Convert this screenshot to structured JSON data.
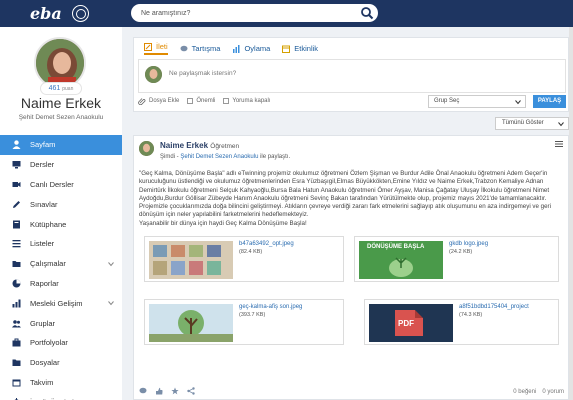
{
  "topbar": {
    "logo": "eba",
    "search_placeholder": "Ne aramıştınız?"
  },
  "profile": {
    "points_value": "461",
    "points_unit": "puan",
    "name": "Naime Erkek",
    "school": "Şehit Demet Sezen Anaokulu"
  },
  "sidebar": {
    "items": [
      {
        "label": "Sayfam",
        "icon": "user-icon",
        "active": true
      },
      {
        "label": "Dersler",
        "icon": "monitor-icon"
      },
      {
        "label": "Canlı Dersler",
        "icon": "video-icon"
      },
      {
        "label": "Sınavlar",
        "icon": "pencil-icon"
      },
      {
        "label": "Kütüphane",
        "icon": "book-icon"
      },
      {
        "label": "Listeler",
        "icon": "list-icon"
      },
      {
        "label": "Çalışmalar",
        "icon": "folder-open-icon",
        "expandable": true
      },
      {
        "label": "Raporlar",
        "icon": "chart-icon"
      },
      {
        "label": "Mesleki Gelişim",
        "icon": "bars-icon",
        "expandable": true
      },
      {
        "label": "Gruplar",
        "icon": "group-icon"
      },
      {
        "label": "Portfolyolar",
        "icon": "briefcase-icon"
      },
      {
        "label": "Dosyalar",
        "icon": "folder-icon"
      },
      {
        "label": "Takvim",
        "icon": "calendar-icon"
      },
      {
        "label": "İçerik Üretimi",
        "icon": "gear-icon",
        "expandable": true
      }
    ]
  },
  "composer": {
    "tabs": [
      {
        "label": "İleti",
        "icon": "pencil-icon",
        "active": true
      },
      {
        "label": "Tartışma",
        "icon": "chat-icon"
      },
      {
        "label": "Oylama",
        "icon": "poll-icon"
      },
      {
        "label": "Etkinlik",
        "icon": "calendar-icon"
      }
    ],
    "input_placeholder": "Ne paylaşmak istersin?",
    "attach_label": "Dosya Ekle",
    "option_draft": "Önemli",
    "option_comments": "Yoruma kapalı",
    "group_select": "Grup Seç",
    "share_button": "PAYLAŞ"
  },
  "filter": {
    "selected": "Tümünü Göster"
  },
  "post": {
    "author": "Naime Erkek",
    "role": "Öğretmen",
    "time": "Şimdi",
    "meta_link": "Şehit Demet Sezen Anaokulu",
    "meta_suffix": "ile paylaştı.",
    "body_1": "\"Geç Kalma, Dönüşüme Başla\" adlı eTwinning projemiz okulumuz öğretmeni Özlem Şişman ve Burdur Adile Önal Anaokulu öğretmeni Adem Geçer'in kuruculuğunu üstlendiği ve okulumuz öğretmenlerinden Esra Yüzbaşıgil,Elmas Büyükkökten,Emine Yıldız ve Naime Erkek,Trabzon Kemaliye Adnan Demirtürk İlkokulu öğretmeni Selçuk Kahyaoğlu,Bursa Bala Hatun Anaokulu öğretmeni Ömer Ayşav, Manisa Çağatay Uluşay İlkokulu öğretmeni Nimet Aydoğdu,Burdur Göllisar Zübeyde Hanım Anaokulu öğretmeni Sevinç Bakan tarafından Yürütülmekte olup, projemiz mayıs 2021'de tamamlanacaktır. Projemizle çocuklarımızda doğa bilincini geliştirmeyi. Atıkların çevreye verdiği zararı fark etmelerini sağlayıp atık oluşumunu en aza indirgemeyi ve geri dönüşüm için neler yapılabilini farketmelerini hedeflemekteyiz.",
    "body_2": "Yaşanabilir bir dünya için haydi Geç Kalma Dönüşüme Başla!",
    "attachments": [
      {
        "name": "b47a63492_opt.jpeg",
        "size": "(82.4 KB)"
      },
      {
        "name": "gkdb logo.jpeg",
        "size": "(24.2 KB)",
        "thumb_text": "DÖNÜŞÜME BAŞLA"
      },
      {
        "name": "geç-kalma-afiş son.jpeg",
        "size": "(393.7 KB)"
      },
      {
        "name": "a8f51bdbd175404_project",
        "size": "(74.3 KB)",
        "thumb_text": "PDF"
      }
    ],
    "likes": "0 beğeni",
    "comments": "0 yorum"
  }
}
